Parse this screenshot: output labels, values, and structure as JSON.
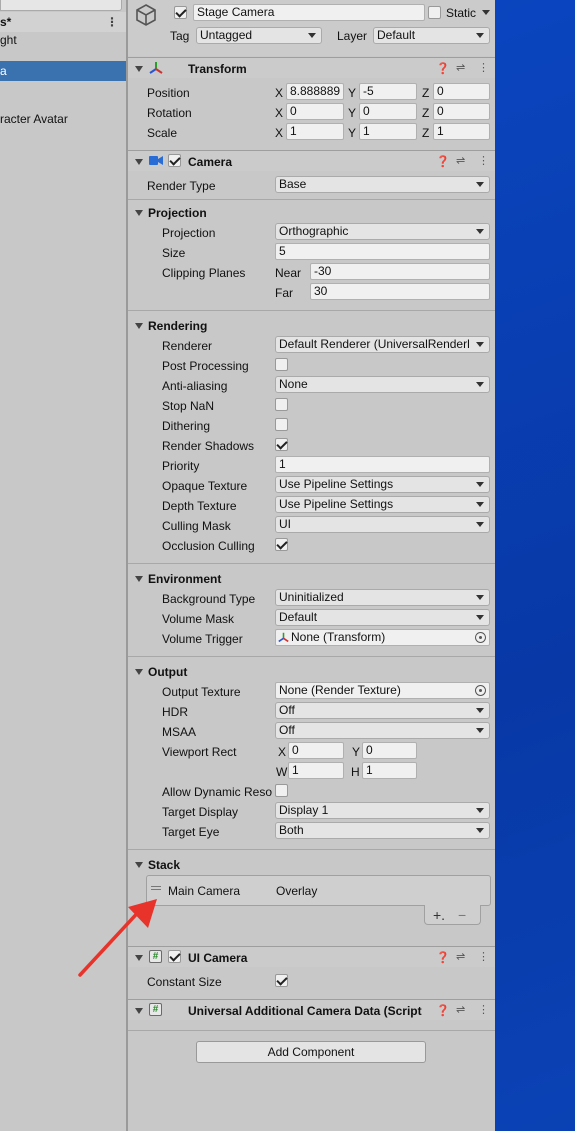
{
  "hierarchy": {
    "items": [
      {
        "label": "s*"
      },
      {
        "label": "ght"
      },
      {
        "label": "a"
      },
      {
        "label": "racter Avatar"
      }
    ]
  },
  "object": {
    "name": "Stage Camera",
    "active": true,
    "static_label": "Static",
    "tag_label": "Tag",
    "tag_value": "Untagged",
    "layer_label": "Layer",
    "layer_value": "Default"
  },
  "transform": {
    "title": "Transform",
    "position_label": "Position",
    "rotation_label": "Rotation",
    "scale_label": "Scale",
    "position": {
      "x": "8.888889",
      "y": "-5",
      "z": "0"
    },
    "rotation": {
      "x": "0",
      "y": "0",
      "z": "0"
    },
    "scale": {
      "x": "1",
      "y": "1",
      "z": "1"
    },
    "axis_x": "X",
    "axis_y": "Y",
    "axis_z": "Z"
  },
  "camera": {
    "title": "Camera",
    "render_type_label": "Render Type",
    "render_type": "Base",
    "projection_header": "Projection",
    "projection_label": "Projection",
    "projection": "Orthographic",
    "size_label": "Size",
    "size": "5",
    "clipping_label": "Clipping Planes",
    "near_label": "Near",
    "near": "-30",
    "far_label": "Far",
    "far": "30",
    "rendering_header": "Rendering",
    "renderer_label": "Renderer",
    "renderer": "Default Renderer (UniversalRenderl",
    "post_label": "Post Processing",
    "aa_label": "Anti-aliasing",
    "aa": "None",
    "stopnan_label": "Stop NaN",
    "dither_label": "Dithering",
    "shadows_label": "Render Shadows",
    "priority_label": "Priority",
    "priority": "1",
    "opaque_label": "Opaque Texture",
    "opaque": "Use Pipeline Settings",
    "depth_label": "Depth Texture",
    "depth": "Use Pipeline Settings",
    "culling_label": "Culling Mask",
    "culling": "UI",
    "occlusion_label": "Occlusion Culling",
    "environment_header": "Environment",
    "bg_label": "Background Type",
    "bg": "Uninitialized",
    "volmask_label": "Volume Mask",
    "volmask": "Default",
    "voltrig_label": "Volume Trigger",
    "voltrig": "None (Transform)",
    "output_header": "Output",
    "outtex_label": "Output Texture",
    "outtex": "None (Render Texture)",
    "hdr_label": "HDR",
    "hdr": "Off",
    "msaa_label": "MSAA",
    "msaa": "Off",
    "viewport_label": "Viewport Rect",
    "vp_x_label": "X",
    "vp_x": "0",
    "vp_y_label": "Y",
    "vp_y": "0",
    "vp_w_label": "W",
    "vp_w": "1",
    "vp_h_label": "H",
    "vp_h": "1",
    "dynres_label": "Allow Dynamic Reso",
    "targetdisplay_label": "Target Display",
    "targetdisplay": "Display 1",
    "targeteye_label": "Target Eye",
    "targeteye": "Both",
    "stack_header": "Stack",
    "stack_item_name": "Main Camera",
    "stack_item_type": "Overlay",
    "add_label": "+.",
    "remove_label": "−"
  },
  "uicamera": {
    "title": "UI Camera",
    "constant_label": "Constant Size"
  },
  "urpdata": {
    "title": "Universal Additional Camera Data (Script"
  },
  "add_component_label": "Add Component",
  "colors": {
    "inspector_bg": "#c8c8c8",
    "selection": "#3a72b0",
    "arrow": "#e8332a",
    "desktop": "#0a41b8"
  }
}
